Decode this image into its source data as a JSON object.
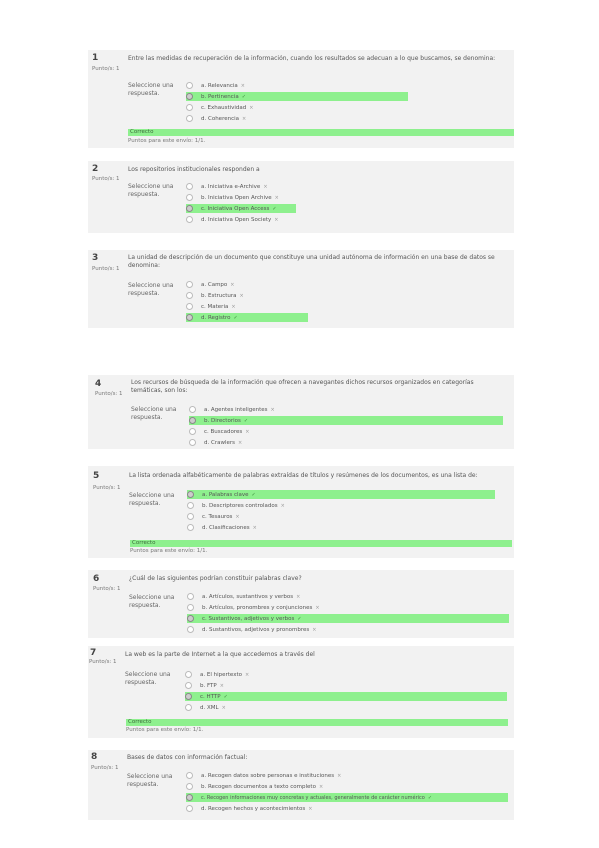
{
  "questions": [
    {
      "num": "1",
      "points": "Punto/s: 1",
      "text": "Entre las medidas de recuperación de la información, cuando los resultados se adecuan a lo que buscamos, se denomina:",
      "prompt": "Seleccione una respuesta.",
      "options": [
        {
          "label": "a. Relevancia",
          "mark": "x",
          "selected": false
        },
        {
          "label": "b. Pertinencia",
          "mark": "check",
          "selected": true
        },
        {
          "label": "c. Exhaustividad",
          "mark": "x",
          "selected": false
        },
        {
          "label": "d. Coherencia",
          "mark": "x",
          "selected": false
        }
      ],
      "feedback": "Correcto",
      "score_line": "Puntos para este envío: 1/1."
    },
    {
      "num": "2",
      "points": "Punto/s: 1",
      "text": "Los repositorios institucionales responden a",
      "prompt": "Seleccione una respuesta.",
      "options": [
        {
          "label": "a. Iniciativa e-Archive",
          "mark": "x",
          "selected": false
        },
        {
          "label": "b. Iniciativa Open Archive",
          "mark": "x",
          "selected": false
        },
        {
          "label": "c. Iniciativa Open Access",
          "mark": "check",
          "selected": true
        },
        {
          "label": "d. Iniciativa Open Society",
          "mark": "x",
          "selected": false
        }
      ]
    },
    {
      "num": "3",
      "points": "Punto/s: 1",
      "text": "La unidad de descripción de un documento que constituye una unidad autónoma de información en una base de datos se denomina:",
      "prompt": "Seleccione una respuesta.",
      "options": [
        {
          "label": "a. Campo",
          "mark": "x",
          "selected": false
        },
        {
          "label": "b. Estructura",
          "mark": "x",
          "selected": false
        },
        {
          "label": "c. Materia",
          "mark": "x",
          "selected": false
        },
        {
          "label": "d. Registro",
          "mark": "check",
          "selected": true
        }
      ]
    },
    {
      "num": "4",
      "points": "Punto/s: 1",
      "text": "Los recursos de búsqueda de la información que ofrecen a navegantes dichos recursos organizados en categorías temáticas, son los:",
      "prompt": "Seleccione una respuesta.",
      "options": [
        {
          "label": "a. Agentes inteligentes",
          "mark": "x",
          "selected": false
        },
        {
          "label": "b. Directorios",
          "mark": "check",
          "selected": true
        },
        {
          "label": "c. Buscadores",
          "mark": "x",
          "selected": false
        },
        {
          "label": "d. Crawlers",
          "mark": "x",
          "selected": false
        }
      ]
    },
    {
      "num": "5",
      "points": "Punto/s: 1",
      "text": "La lista ordenada alfabéticamente de palabras extraídas de títulos y resúmenes de los documentos, es una lista de:",
      "prompt": "Seleccione una respuesta.",
      "options": [
        {
          "label": "a. Palabras clave",
          "mark": "check",
          "selected": true
        },
        {
          "label": "b. Descriptores controlados",
          "mark": "x",
          "selected": false
        },
        {
          "label": "c. Tesauros",
          "mark": "x",
          "selected": false
        },
        {
          "label": "d. Clasificaciones",
          "mark": "x",
          "selected": false
        }
      ],
      "feedback": "Correcto",
      "score_line": "Puntos para este envío: 1/1."
    },
    {
      "num": "6",
      "points": "Punto/s: 1",
      "text": "¿Cuál de las siguientes podrían constituir palabras clave?",
      "prompt": "Seleccione una respuesta.",
      "options": [
        {
          "label": "a. Artículos, sustantivos y verbos",
          "mark": "x",
          "selected": false
        },
        {
          "label": "b. Artículos, pronombres y conjunciones",
          "mark": "x",
          "selected": false
        },
        {
          "label": "c. Sustantivos, adjetivos y verbos",
          "mark": "check",
          "selected": true
        },
        {
          "label": "d. Sustantivos, adjetivos y pronombres",
          "mark": "x",
          "selected": false
        }
      ]
    },
    {
      "num": "7",
      "points": "Punto/s: 1",
      "text": "La web es la parte de Internet a la que accedemos a través del",
      "prompt": "Seleccione una respuesta.",
      "options": [
        {
          "label": "a. El hipertexto",
          "mark": "x",
          "selected": false
        },
        {
          "label": "b. FTP",
          "mark": "x",
          "selected": false
        },
        {
          "label": "c. HTTP",
          "mark": "check",
          "selected": true
        },
        {
          "label": "d. XML",
          "mark": "x",
          "selected": false
        }
      ],
      "feedback": "Correcto",
      "score_line": "Puntos para este envío: 1/1."
    },
    {
      "num": "8",
      "points": "Punto/s: 1",
      "text": "Bases de datos con información factual:",
      "prompt": "Seleccione una respuesta.",
      "options": [
        {
          "label": "a. Recogen datos sobre personas e instituciones",
          "mark": "x",
          "selected": false
        },
        {
          "label": "b. Recogen documentos a texto completo",
          "mark": "x",
          "selected": false
        },
        {
          "label": "c. Recogen informaciones muy concretas y actuales, generalmente de carácter numérico",
          "mark": "check",
          "selected": true
        },
        {
          "label": "d. Recogen hechos y acontecimientos",
          "mark": "x",
          "selected": false
        }
      ]
    }
  ],
  "colors": {
    "selected_bg": "#8ef08e",
    "block_bg": "#f2f2f2",
    "check": "#3a8a3a"
  }
}
